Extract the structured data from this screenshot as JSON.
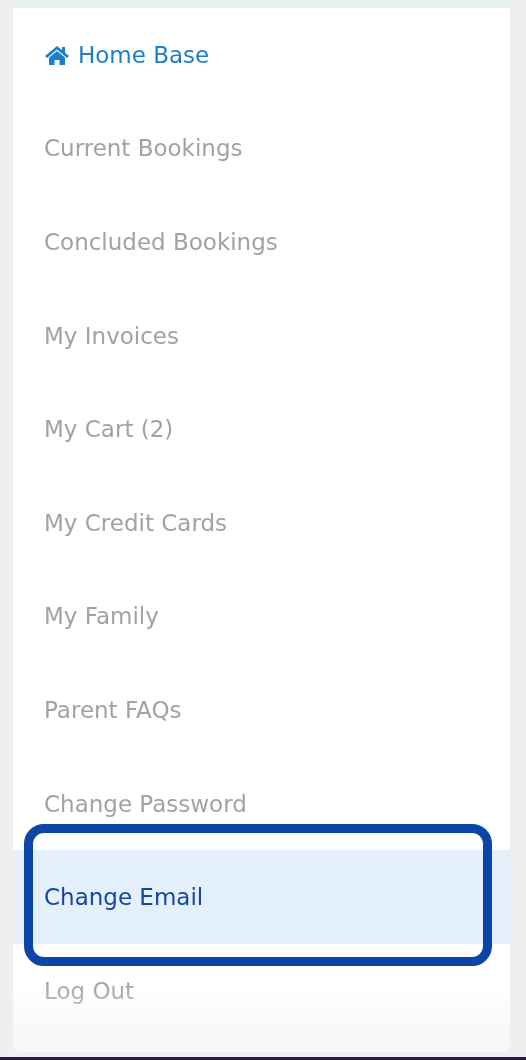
{
  "menu": {
    "items": [
      {
        "label": "Home Base",
        "kind": "home",
        "selected": false
      },
      {
        "label": "Current Bookings",
        "kind": "link",
        "selected": false
      },
      {
        "label": "Concluded Bookings",
        "kind": "link",
        "selected": false
      },
      {
        "label": "My Invoices",
        "kind": "link",
        "selected": false
      },
      {
        "label": "My Cart (2)",
        "kind": "link",
        "selected": false
      },
      {
        "label": "My Credit Cards",
        "kind": "link",
        "selected": false
      },
      {
        "label": "My Family",
        "kind": "link",
        "selected": false
      },
      {
        "label": "Parent FAQs",
        "kind": "link",
        "selected": false
      },
      {
        "label": "Change Password",
        "kind": "link",
        "selected": false
      },
      {
        "label": "Change Email",
        "kind": "link",
        "selected": true
      },
      {
        "label": "Log Out",
        "kind": "link",
        "selected": false
      }
    ]
  }
}
